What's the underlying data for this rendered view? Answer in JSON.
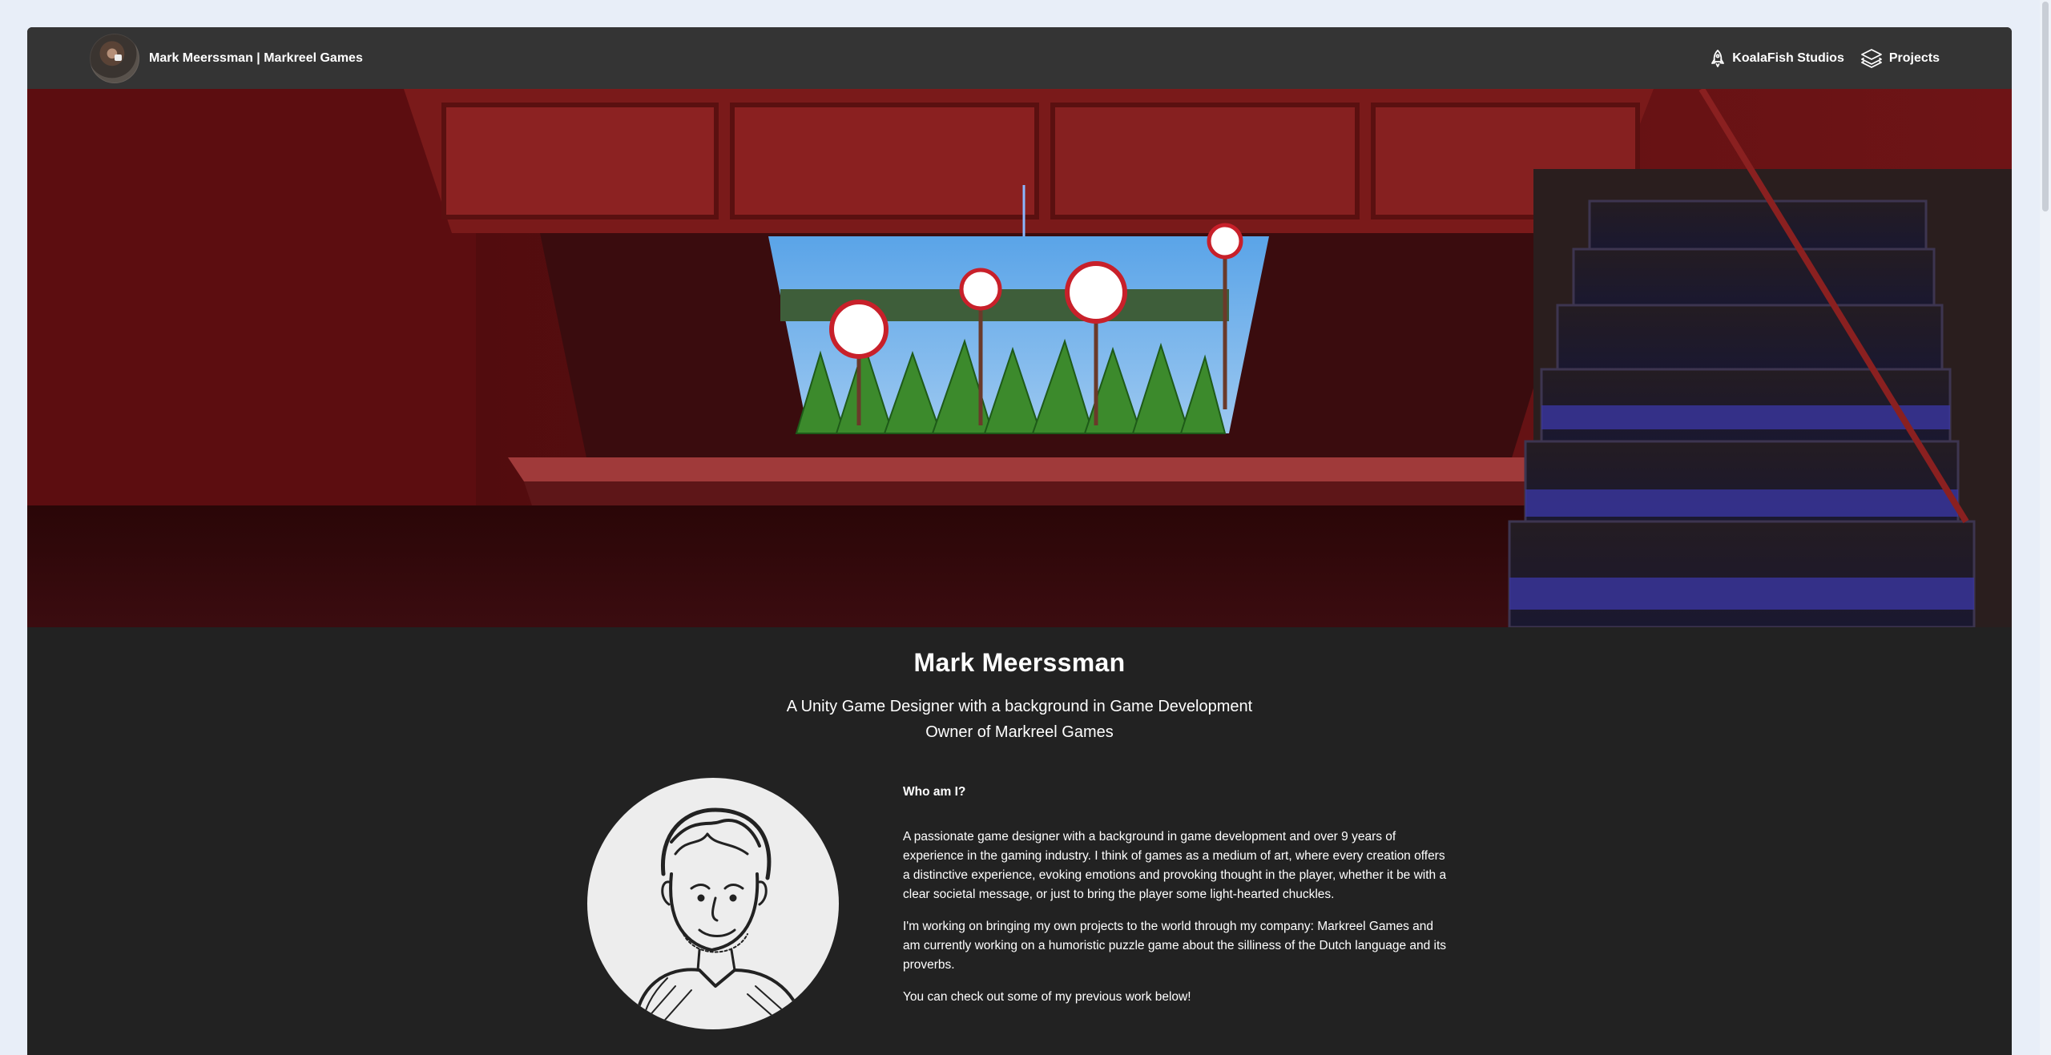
{
  "navbar": {
    "brand_label": "Mark Meerssman | Markreel Games",
    "links": [
      {
        "label": "KoalaFish Studios",
        "icon": "rocket-icon"
      },
      {
        "label": "Projects",
        "icon": "layers-icon"
      }
    ]
  },
  "profile": {
    "name": "Mark Meerssman",
    "tagline_line1": "A Unity Game Designer with a background in Game Development",
    "tagline_line2": "Owner of Markreel Games"
  },
  "about": {
    "heading": "Who am I?",
    "paragraphs": [
      "A passionate game designer with a background in game development and over 9 years of experience in the gaming industry. I think of games as a medium of art, where every creation offers a distinctive experience, evoking emotions and provoking thought in the player, whether it be with a clear societal message, or just to bring the player some light-hearted chuckles.",
      "I'm working on bringing my own projects to the world through my company: Markreel Games and am currently working on a humoristic puzzle game about the silliness of the Dutch language and its proverbs.",
      "You can check out some of my previous work below!"
    ]
  },
  "colors": {
    "page_bg": "#e8eef8",
    "navbar_bg": "#343434",
    "content_bg": "#222222",
    "text": "#ffffff"
  }
}
